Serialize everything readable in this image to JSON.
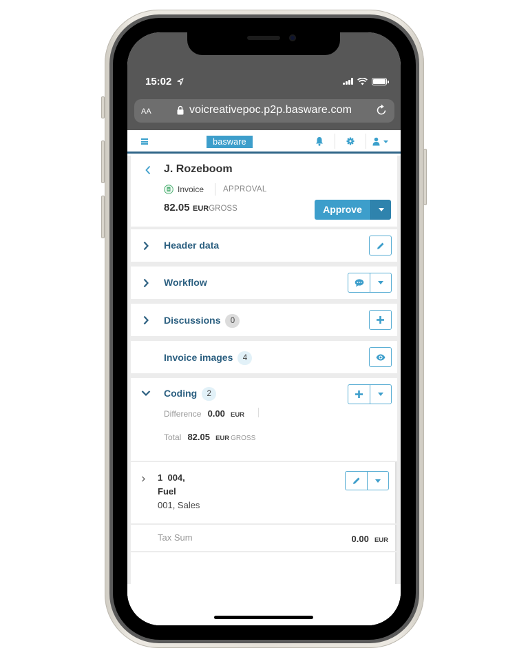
{
  "status_bar": {
    "time": "15:02",
    "icons": [
      "location-arrow-icon",
      "signal-icon",
      "wifi-icon",
      "battery-icon"
    ]
  },
  "browser": {
    "text_size_label": "AA",
    "url": "voicreativepoc.p2p.basware.com",
    "icons": [
      "lock-icon",
      "reload-icon"
    ]
  },
  "app_header": {
    "logo_text": "basware",
    "icons": [
      "hamburger-menu-icon",
      "bell-icon",
      "gear-icon",
      "user-icon",
      "caret-down-icon"
    ],
    "accent_color": "#3d9ecb",
    "border_color": "#2f6588"
  },
  "document": {
    "supplier": "J. Rozeboom",
    "type": "Invoice",
    "status": "APPROVAL",
    "amount": "82.05",
    "currency": "EUR",
    "amount_type": "GROSS",
    "approve_label": "Approve"
  },
  "sections": {
    "header_data": {
      "title": "Header data"
    },
    "workflow": {
      "title": "Workflow"
    },
    "discussions": {
      "title": "Discussions",
      "count": "0"
    },
    "invoice_images": {
      "title": "Invoice images",
      "count": "4"
    },
    "coding": {
      "title": "Coding",
      "count": "2",
      "difference_label": "Difference",
      "difference_value": "0.00",
      "difference_currency": "EUR",
      "total_label": "Total",
      "total_value": "82.05",
      "total_currency": "EUR",
      "total_type": "GROSS"
    }
  },
  "coding_lines": [
    {
      "line_number": "1",
      "account_code": "004,",
      "account_name": "Fuel",
      "cost_center": "001, Sales"
    }
  ],
  "tax_sum": {
    "label": "Tax Sum",
    "value": "0.00",
    "currency": "EUR"
  }
}
